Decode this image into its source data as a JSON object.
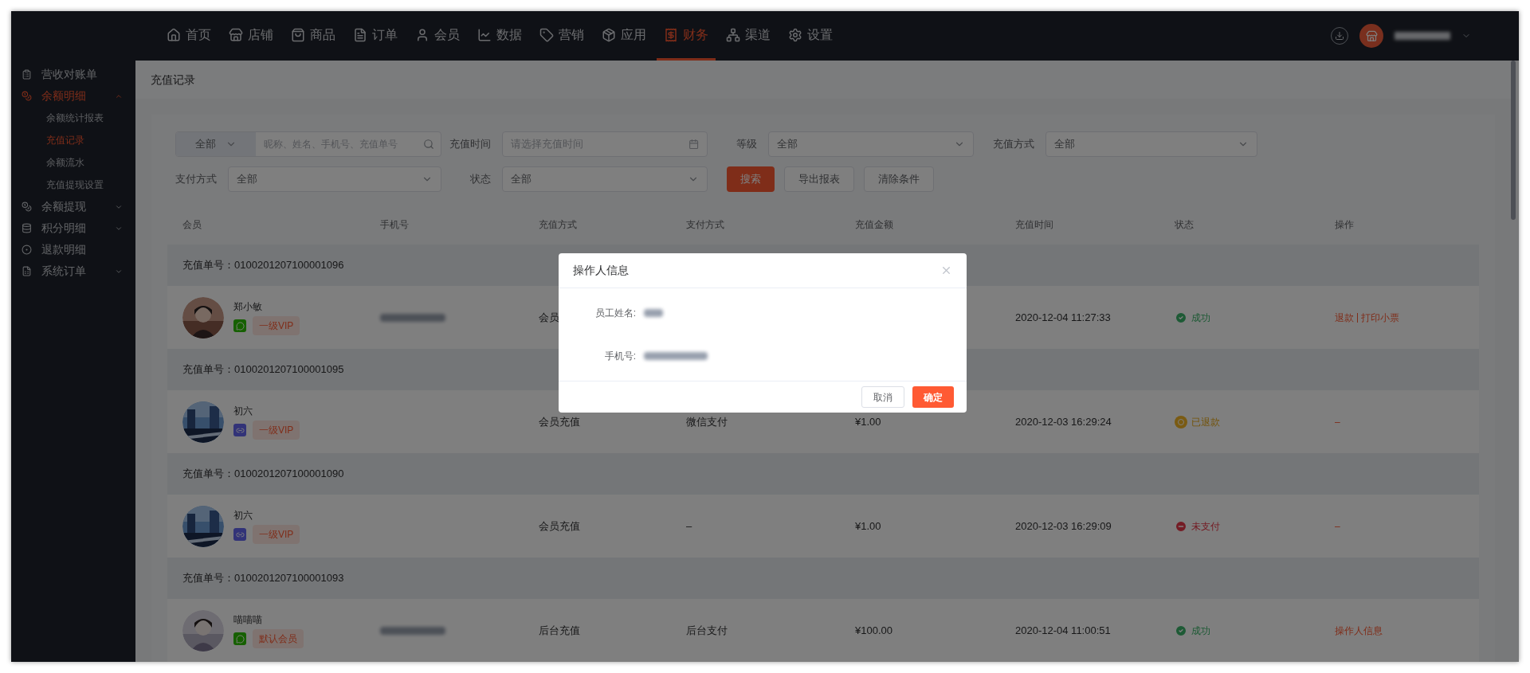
{
  "nav": {
    "items": [
      {
        "label": "首页",
        "selected": false
      },
      {
        "label": "店铺",
        "selected": false
      },
      {
        "label": "商品",
        "selected": false
      },
      {
        "label": "订单",
        "selected": false
      },
      {
        "label": "会员",
        "selected": false
      },
      {
        "label": "数据",
        "selected": false
      },
      {
        "label": "营销",
        "selected": false
      },
      {
        "label": "应用",
        "selected": false
      },
      {
        "label": "财务",
        "selected": true
      },
      {
        "label": "渠道",
        "selected": false
      },
      {
        "label": "设置",
        "selected": false
      }
    ]
  },
  "sidebar": {
    "items": [
      {
        "label": "营收对账单",
        "selected": false
      },
      {
        "label": "余额明细",
        "selected": true,
        "expanded": true,
        "children": [
          {
            "label": "余额统计报表",
            "selected": false
          },
          {
            "label": "充值记录",
            "selected": true
          },
          {
            "label": "余额流水",
            "selected": false
          },
          {
            "label": "充值提现设置",
            "selected": false
          }
        ]
      },
      {
        "label": "余额提现",
        "selected": false,
        "expanded": false
      },
      {
        "label": "积分明细",
        "selected": false,
        "expanded": false
      },
      {
        "label": "退款明细",
        "selected": false
      },
      {
        "label": "系统订单",
        "selected": false,
        "expanded": false
      }
    ]
  },
  "page_title": "充值记录",
  "filters": {
    "search": {
      "scope": "全部",
      "placeholder": "昵称、姓名、手机号、充值单号"
    },
    "fields": [
      {
        "label": "充值时间",
        "kind": "date",
        "placeholder": "请选择充值时间"
      },
      {
        "label": "等级",
        "kind": "select",
        "value": "全部"
      },
      {
        "label": "充值方式",
        "kind": "select",
        "value": "全部"
      },
      {
        "label": "支付方式",
        "kind": "select",
        "value": "全部"
      },
      {
        "label": "状态",
        "kind": "select",
        "value": "全部"
      }
    ],
    "buttons": [
      {
        "label": "搜索",
        "primary": true
      },
      {
        "label": "导出报表",
        "primary": false
      },
      {
        "label": "清除条件",
        "primary": false
      }
    ]
  },
  "table": {
    "columns": [
      "会员",
      "手机号",
      "充值方式",
      "支付方式",
      "充值金额",
      "充值时间",
      "状态",
      "操作"
    ],
    "rows": [
      {
        "order": "充值单号：0100201207100001096",
        "avatar": {
          "kind": "picture"
        },
        "name": "郑小敏",
        "channel": {
          "kind": "wechat"
        },
        "level": "一级VIP",
        "phone": {
          "blurred": true
        },
        "method": "会员",
        "time": "2020-12-04 11:27:33",
        "status": {
          "kind": "success",
          "label": "成功"
        },
        "actions": [
          "退款",
          "打印小票"
        ]
      },
      {
        "order": "充值单号：0100201207100001095",
        "avatar": {
          "kind": "picture"
        },
        "name": "初六",
        "channel": {
          "kind": "miniprogram"
        },
        "level": "一级VIP",
        "method": "会员充值",
        "payment": "微信支付",
        "amount": "¥1.00",
        "time": "2020-12-03 16:29:24",
        "status": {
          "kind": "refunded",
          "label": "已退款"
        },
        "actions": [
          "–"
        ]
      },
      {
        "order": "充值单号：0100201207100001090",
        "avatar": {
          "kind": "picture"
        },
        "name": "初六",
        "channel": {
          "kind": "miniprogram"
        },
        "level": "一级VIP",
        "method": "会员充值",
        "payment": "–",
        "amount": "¥1.00",
        "time": "2020-12-03 16:29:09",
        "status": {
          "kind": "unpaid",
          "label": "未支付"
        },
        "actions": [
          "–"
        ]
      },
      {
        "order": "充值单号：0100201207100001093",
        "avatar": {
          "kind": "picture"
        },
        "name": "喵喵喵",
        "channel": {
          "kind": "wechat"
        },
        "level": "默认会员",
        "phone": {
          "blurred": true
        },
        "method": "后台充值",
        "payment": "后台支付",
        "amount": "¥100.00",
        "time": "2020-12-04 11:00:51",
        "status": {
          "kind": "success",
          "label": "成功"
        },
        "actions": [
          "操作人信息"
        ]
      }
    ]
  },
  "dialog": {
    "title": "操作人信息",
    "fields": [
      {
        "label": "员工姓名:",
        "blurred": true
      },
      {
        "label": "手机号:",
        "blurred": true
      }
    ],
    "buttons": [
      {
        "label": "取消",
        "primary": false
      },
      {
        "label": "确定",
        "primary": true
      }
    ]
  }
}
